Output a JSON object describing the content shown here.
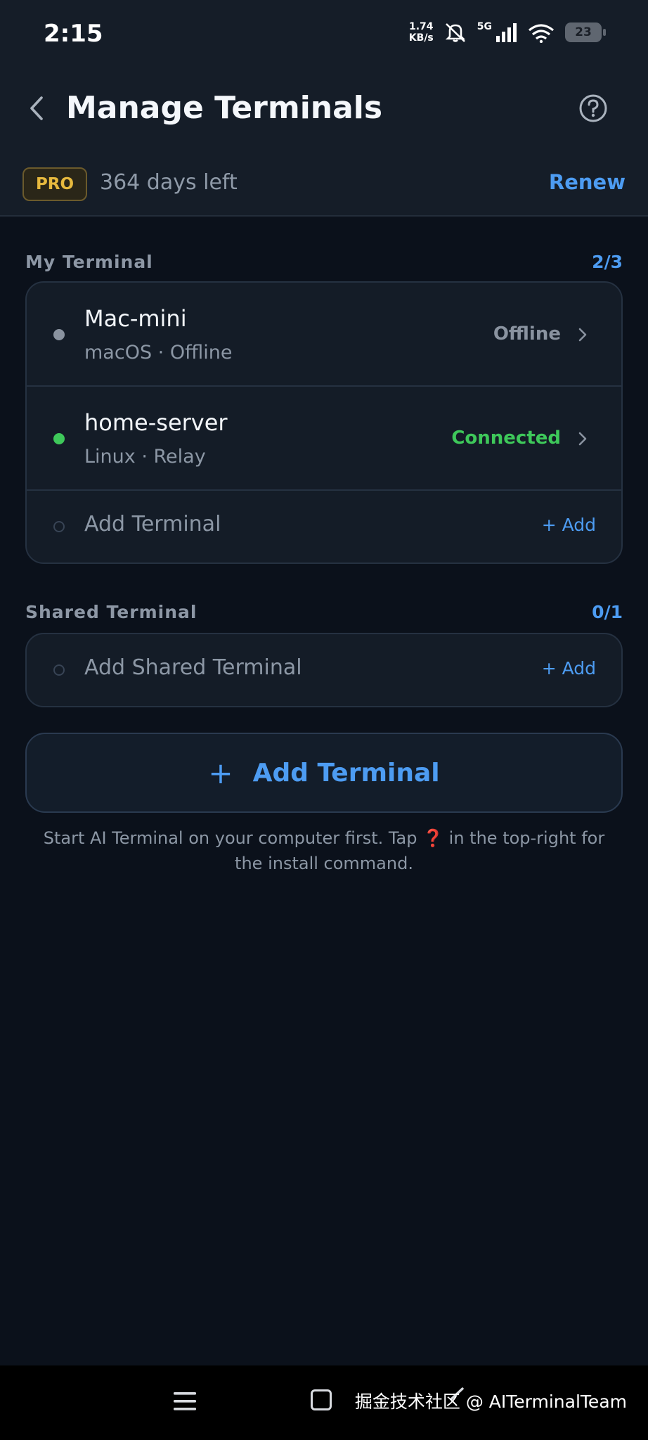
{
  "status_bar": {
    "time": "2:15",
    "net_speed_value": "1.74",
    "net_speed_unit": "KB/s",
    "network_type": "5G",
    "battery": "23"
  },
  "header": {
    "title": "Manage Terminals"
  },
  "subscription": {
    "badge": "PRO",
    "days_left": "364 days left",
    "renew_label": "Renew"
  },
  "my_terminal": {
    "label": "My Terminal",
    "count": "2/3",
    "items": [
      {
        "name": "Mac-mini",
        "os": "macOS",
        "mode": "Offline",
        "status": "Offline",
        "status_color": "#8a93a0"
      },
      {
        "name": "home-server",
        "os": "Linux",
        "mode": "Relay",
        "status": "Connected",
        "status_color": "#3ec85a"
      }
    ],
    "add_label": "Add Terminal",
    "add_link": "+ Add"
  },
  "shared_terminal": {
    "label": "Shared Terminal",
    "count": "0/1",
    "add_label": "Add Shared Terminal",
    "add_link": "+ Add"
  },
  "add_terminal_button": {
    "plus": "+",
    "label": "Add Terminal"
  },
  "hint": {
    "before": "Start AI Terminal on your computer first. Tap",
    "icon": "❓",
    "after": "in the top-right for the install command."
  },
  "watermark": "掘金技术社区 @ AITerminalTeam",
  "colors": {
    "accent": "#4d9cf2",
    "connected": "#3ec85a",
    "pro": "#e7b93e",
    "background": "#0b111b"
  }
}
